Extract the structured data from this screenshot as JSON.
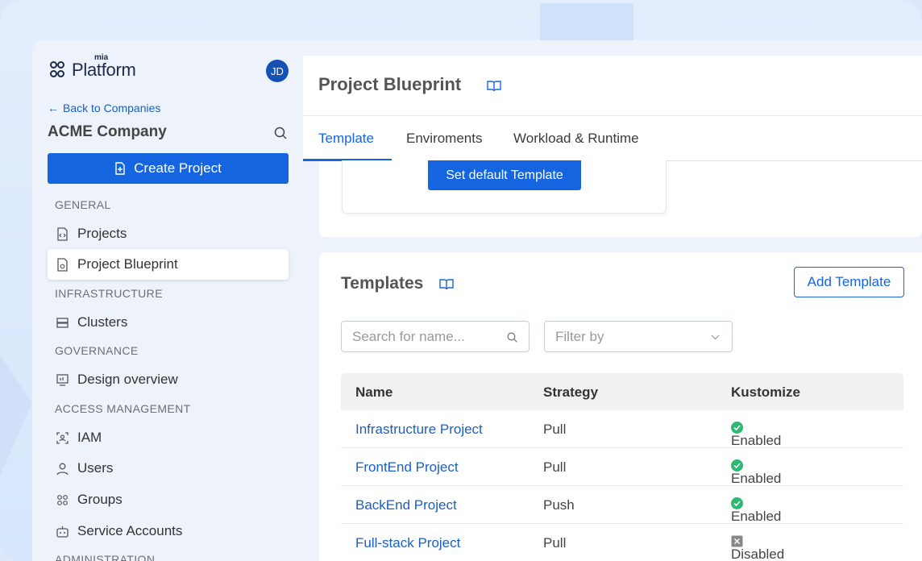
{
  "app": {
    "logo_small": "mia",
    "logo_text": "Platform",
    "avatar_initials": "JD"
  },
  "sidebar": {
    "back_label": "Back to Companies",
    "company": "ACME Company",
    "create_label": "Create Project",
    "sections": {
      "general": "GENERAL",
      "infrastructure": "INFRASTRUCTURE",
      "governance": "GOVERNANCE",
      "access": "ACCESS MANAGEMENT",
      "administration": "ADMINISTRATION"
    },
    "items": [
      {
        "label": "Projects",
        "icon": "file-code-icon"
      },
      {
        "label": "Project Blueprint",
        "icon": "file-gear-icon"
      },
      {
        "label": "Clusters",
        "icon": "server-icon"
      },
      {
        "label": "Design overview",
        "icon": "chart-board-icon"
      },
      {
        "label": "IAM",
        "icon": "face-scan-icon"
      },
      {
        "label": "Users",
        "icon": "user-icon"
      },
      {
        "label": "Groups",
        "icon": "group-icon"
      },
      {
        "label": "Service Accounts",
        "icon": "robot-icon"
      }
    ]
  },
  "header": {
    "title": "Project Blueprint"
  },
  "tabs": [
    {
      "label": "Template",
      "active": true
    },
    {
      "label": "Enviroments",
      "active": false
    },
    {
      "label": "Workload & Runtime",
      "active": false
    }
  ],
  "top_card": {
    "button_label": "Set default Template"
  },
  "templates": {
    "title": "Templates",
    "add_label": "Add Template",
    "search_placeholder": "Search for name...",
    "filter_placeholder": "Filter by",
    "columns": [
      "Name",
      "Strategy",
      "Kustomize"
    ],
    "rows": [
      {
        "name": "Infrastructure Project",
        "strategy": "Pull",
        "kustomize": "Enabled"
      },
      {
        "name": "FrontEnd Project",
        "strategy": "Pull",
        "kustomize": "Enabled"
      },
      {
        "name": "BackEnd Project",
        "strategy": "Push",
        "kustomize": "Enabled"
      },
      {
        "name": "Full-stack Project",
        "strategy": "Pull",
        "kustomize": "Disabled"
      }
    ]
  },
  "colors": {
    "primary": "#1565e0",
    "link": "#1a5fc4",
    "enabled": "#2eb872",
    "disabled": "#888888"
  }
}
